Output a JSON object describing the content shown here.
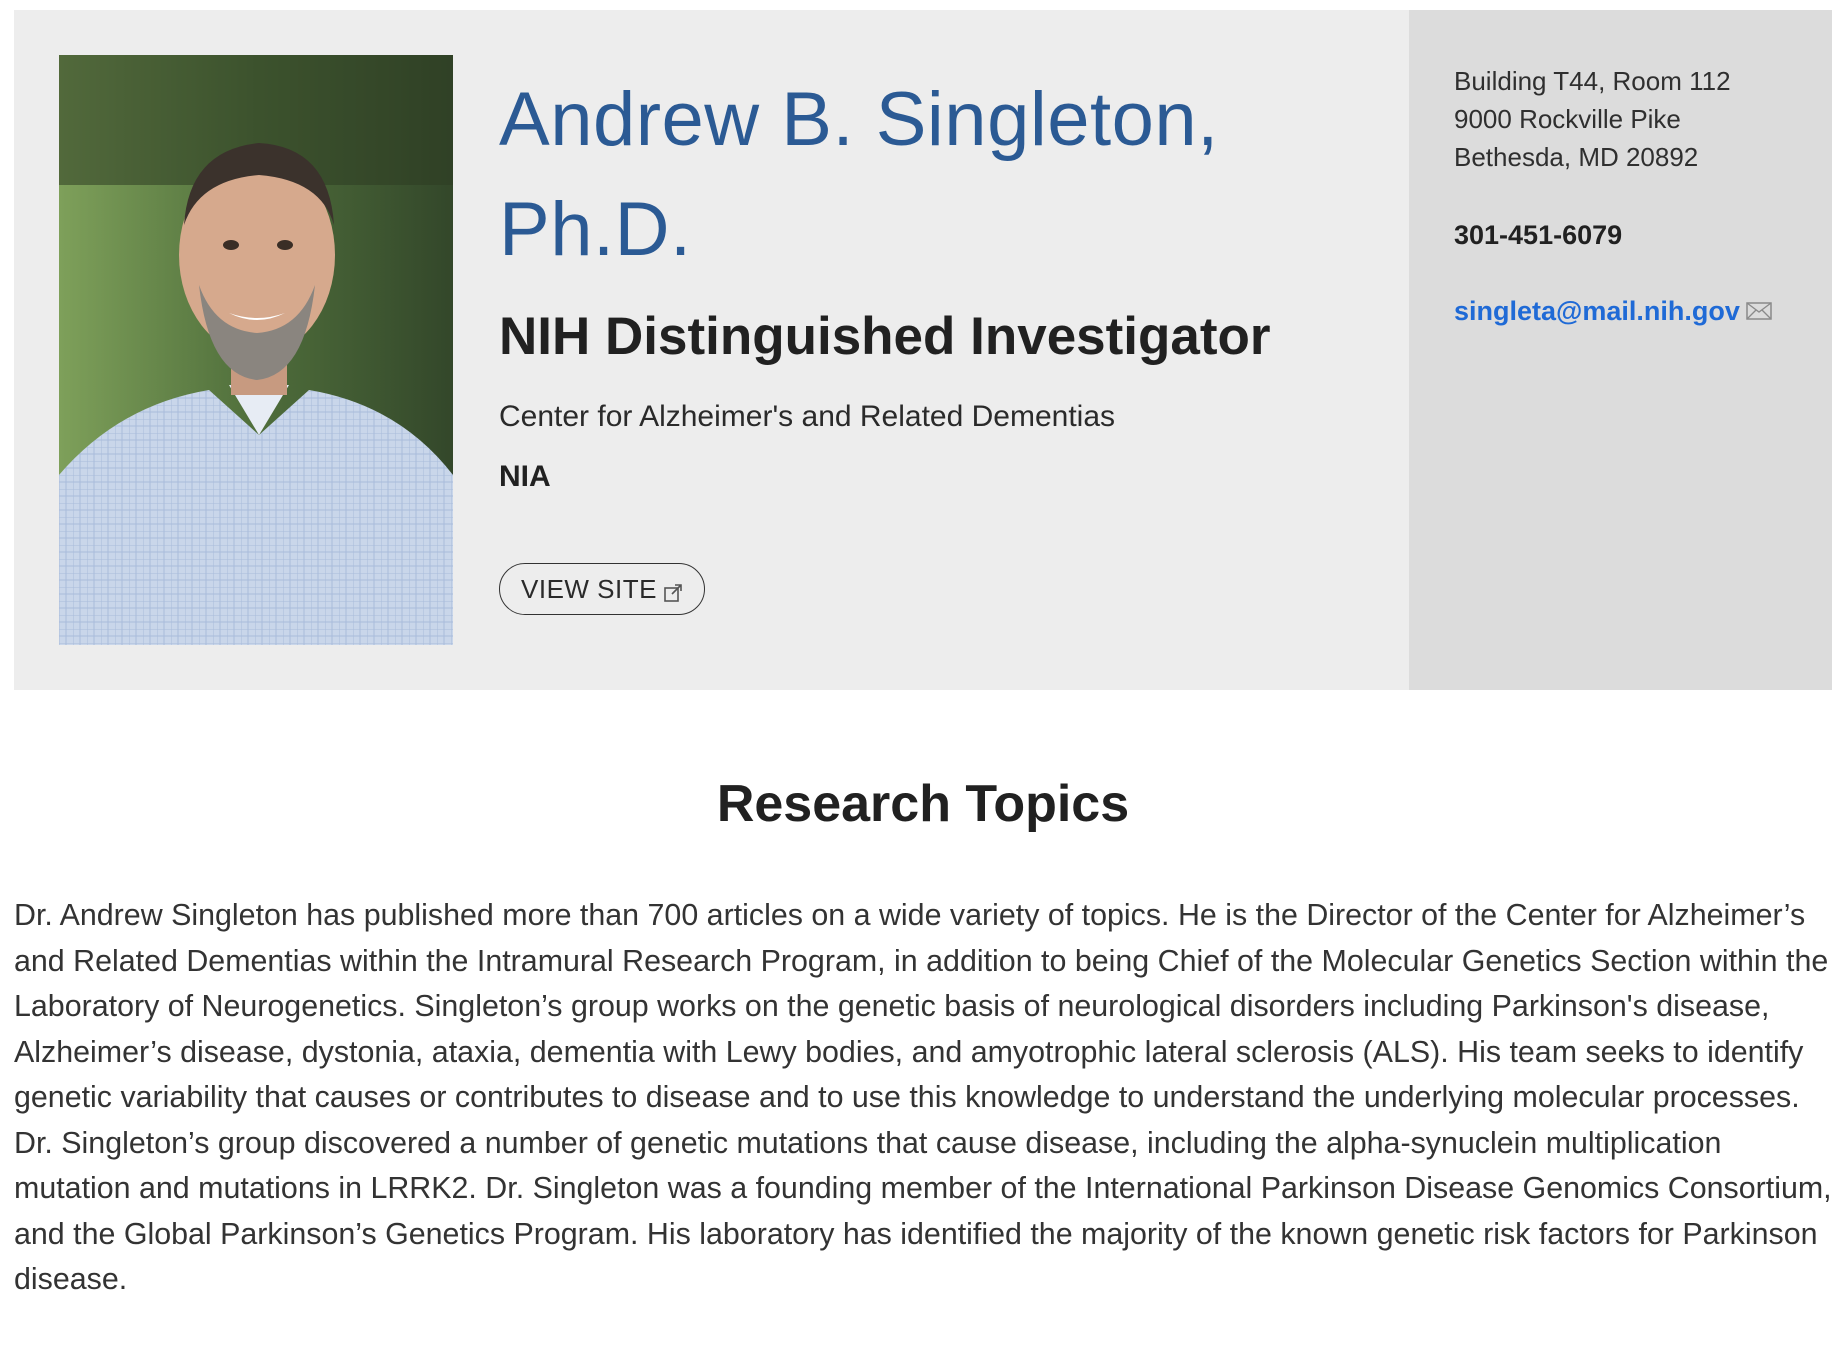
{
  "profile": {
    "name": "Andrew B. Singleton, Ph.D.",
    "title": "NIH Distinguished Investigator",
    "center": "Center for Alzheimer's and Related Dementias",
    "institute": "NIA",
    "view_site_label": "VIEW SITE",
    "photo_alt": "Andrew B. Singleton, Ph.D.",
    "icons": {
      "view_site": "external-link-icon",
      "email": "mail-envelope-icon"
    }
  },
  "contact": {
    "address": [
      "Building T44, Room 112",
      "9000 Rockville Pike",
      "Bethesda, MD 20892"
    ],
    "phone": "301-451-6079",
    "email": "singleta@mail.nih.gov"
  },
  "research": {
    "heading": "Research Topics",
    "body": "Dr. Andrew Singleton has published more than 700 articles on a wide variety of topics. He is the Director of the Center for Alzheimer’s and Related Dementias within the Intramural Research Program, in addition to being Chief of the Molecular Genetics Section within the Laboratory of Neurogenetics. Singleton’s group works on the genetic basis of neurological disorders including Parkinson's disease, Alzheimer’s disease, dystonia, ataxia, dementia with Lewy bodies, and amyotrophic lateral sclerosis (ALS). His team seeks to identify genetic variability that causes or contributes to disease and to use this knowledge to understand the underlying molecular processes. Dr. Singleton’s group discovered a number of genetic mutations that cause disease, including the alpha-synuclein multiplication mutation and mutations in LRRK2. Dr. Singleton was a founding member of the International Parkinson Disease Genomics Consortium, and the Global Parkinson’s Genetics Program. His laboratory has identified the majority of the known genetic risk factors for Parkinson disease."
  },
  "colors": {
    "name_blue": "#2b5a94",
    "email_blue": "#1f6ad6",
    "profile_bg": "#ededed",
    "contact_bg": "#dcdcdc"
  }
}
